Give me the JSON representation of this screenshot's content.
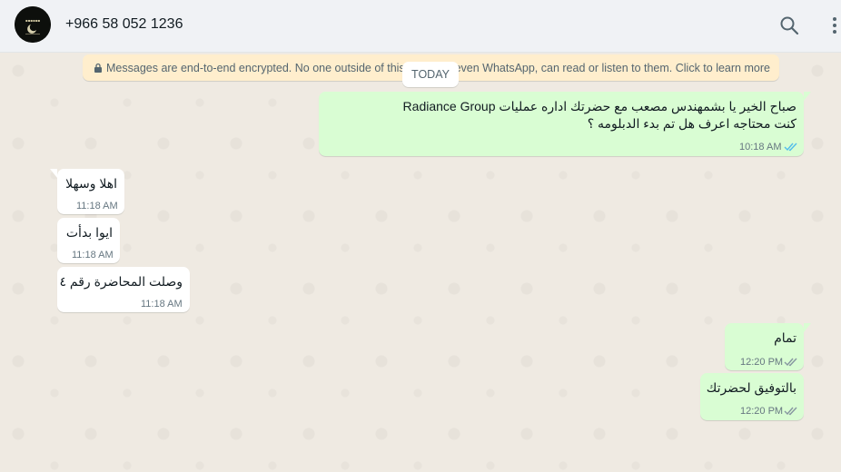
{
  "header": {
    "contact_name": "+966 58 052 1236",
    "avatar": "avatar-icon",
    "search_icon": "search-icon",
    "menu_icon": "kebab-menu-icon"
  },
  "colors": {
    "header_bg": "#f0f2f5",
    "chat_bg": "#efeae2",
    "incoming_bubble": "#ffffff",
    "outgoing_bubble": "#d9fdd3",
    "encryption_notice_bg": "#ffeecd",
    "read_ticks": "#53bdeb",
    "delivered_ticks": "#8696a0"
  },
  "encryption_notice": {
    "text": "Messages are end-to-end encrypted. No one outside of this chat, not even WhatsApp, can read or listen to them. Click to learn more",
    "icon": "lock-icon"
  },
  "date_separator": "TODAY",
  "messages": [
    {
      "direction": "outgoing",
      "lines": [
        "صباح الخير يا بشمهندس مصعب مع حضرتك اداره عمليات Radiance Group",
        "كنت محتاجه اعرف هل تم بدء الدبلومه ؟"
      ],
      "time": "10:18 AM",
      "status": "read"
    },
    {
      "direction": "incoming",
      "lines": [
        "اهلا وسهلا"
      ],
      "time": "11:18 AM"
    },
    {
      "direction": "incoming",
      "lines": [
        "ايوا بدأت"
      ],
      "time": "11:18 AM"
    },
    {
      "direction": "incoming",
      "lines": [
        "وصلت المحاضرة رقم ٤"
      ],
      "time": "11:18 AM"
    },
    {
      "direction": "outgoing",
      "lines": [
        "تمام"
      ],
      "time": "12:20 PM",
      "status": "delivered"
    },
    {
      "direction": "outgoing",
      "lines": [
        "بالتوفيق لحضرتك"
      ],
      "time": "12:20 PM",
      "status": "delivered"
    }
  ]
}
